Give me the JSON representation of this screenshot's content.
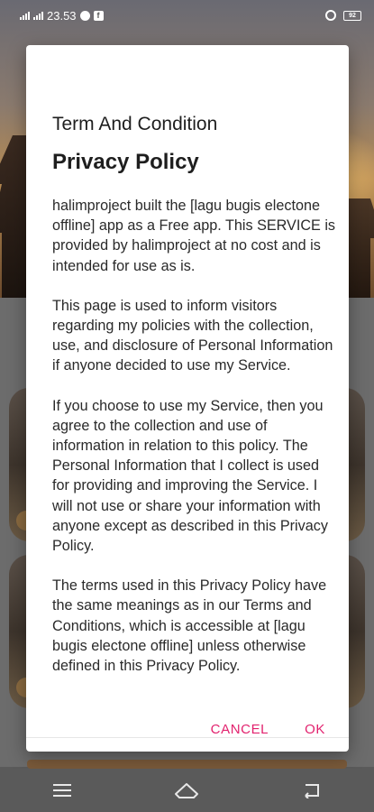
{
  "status_bar": {
    "time": "23.53",
    "battery": "92"
  },
  "dialog": {
    "title": "Term And Condition",
    "heading": "Privacy Policy",
    "paragraphs": [
      "halimproject built the [lagu bugis electone offline] app as a Free app. This SERVICE is provided by halimproject at no cost and is intended for use as is.",
      "This page is used to inform visitors regarding my policies with the collection, use, and disclosure of Personal Information if anyone decided to use my Service.",
      "If you choose to use my Service, then you agree to the collection and use of information in relation to this policy. The Personal Information that I collect is used for providing and improving the Service. I will not use or share your information with anyone except as described in this Privacy Policy.",
      "The terms used in this Privacy Policy have the same meanings as in our Terms and Conditions, which is accessible at [lagu bugis electone offline] unless otherwise defined in this Privacy Policy."
    ],
    "cancel_label": "CANCEL",
    "ok_label": "OK",
    "accent_color": "#e2226e"
  },
  "nav_bar": {
    "icons": [
      "menu-icon",
      "home-icon",
      "back-icon"
    ]
  }
}
